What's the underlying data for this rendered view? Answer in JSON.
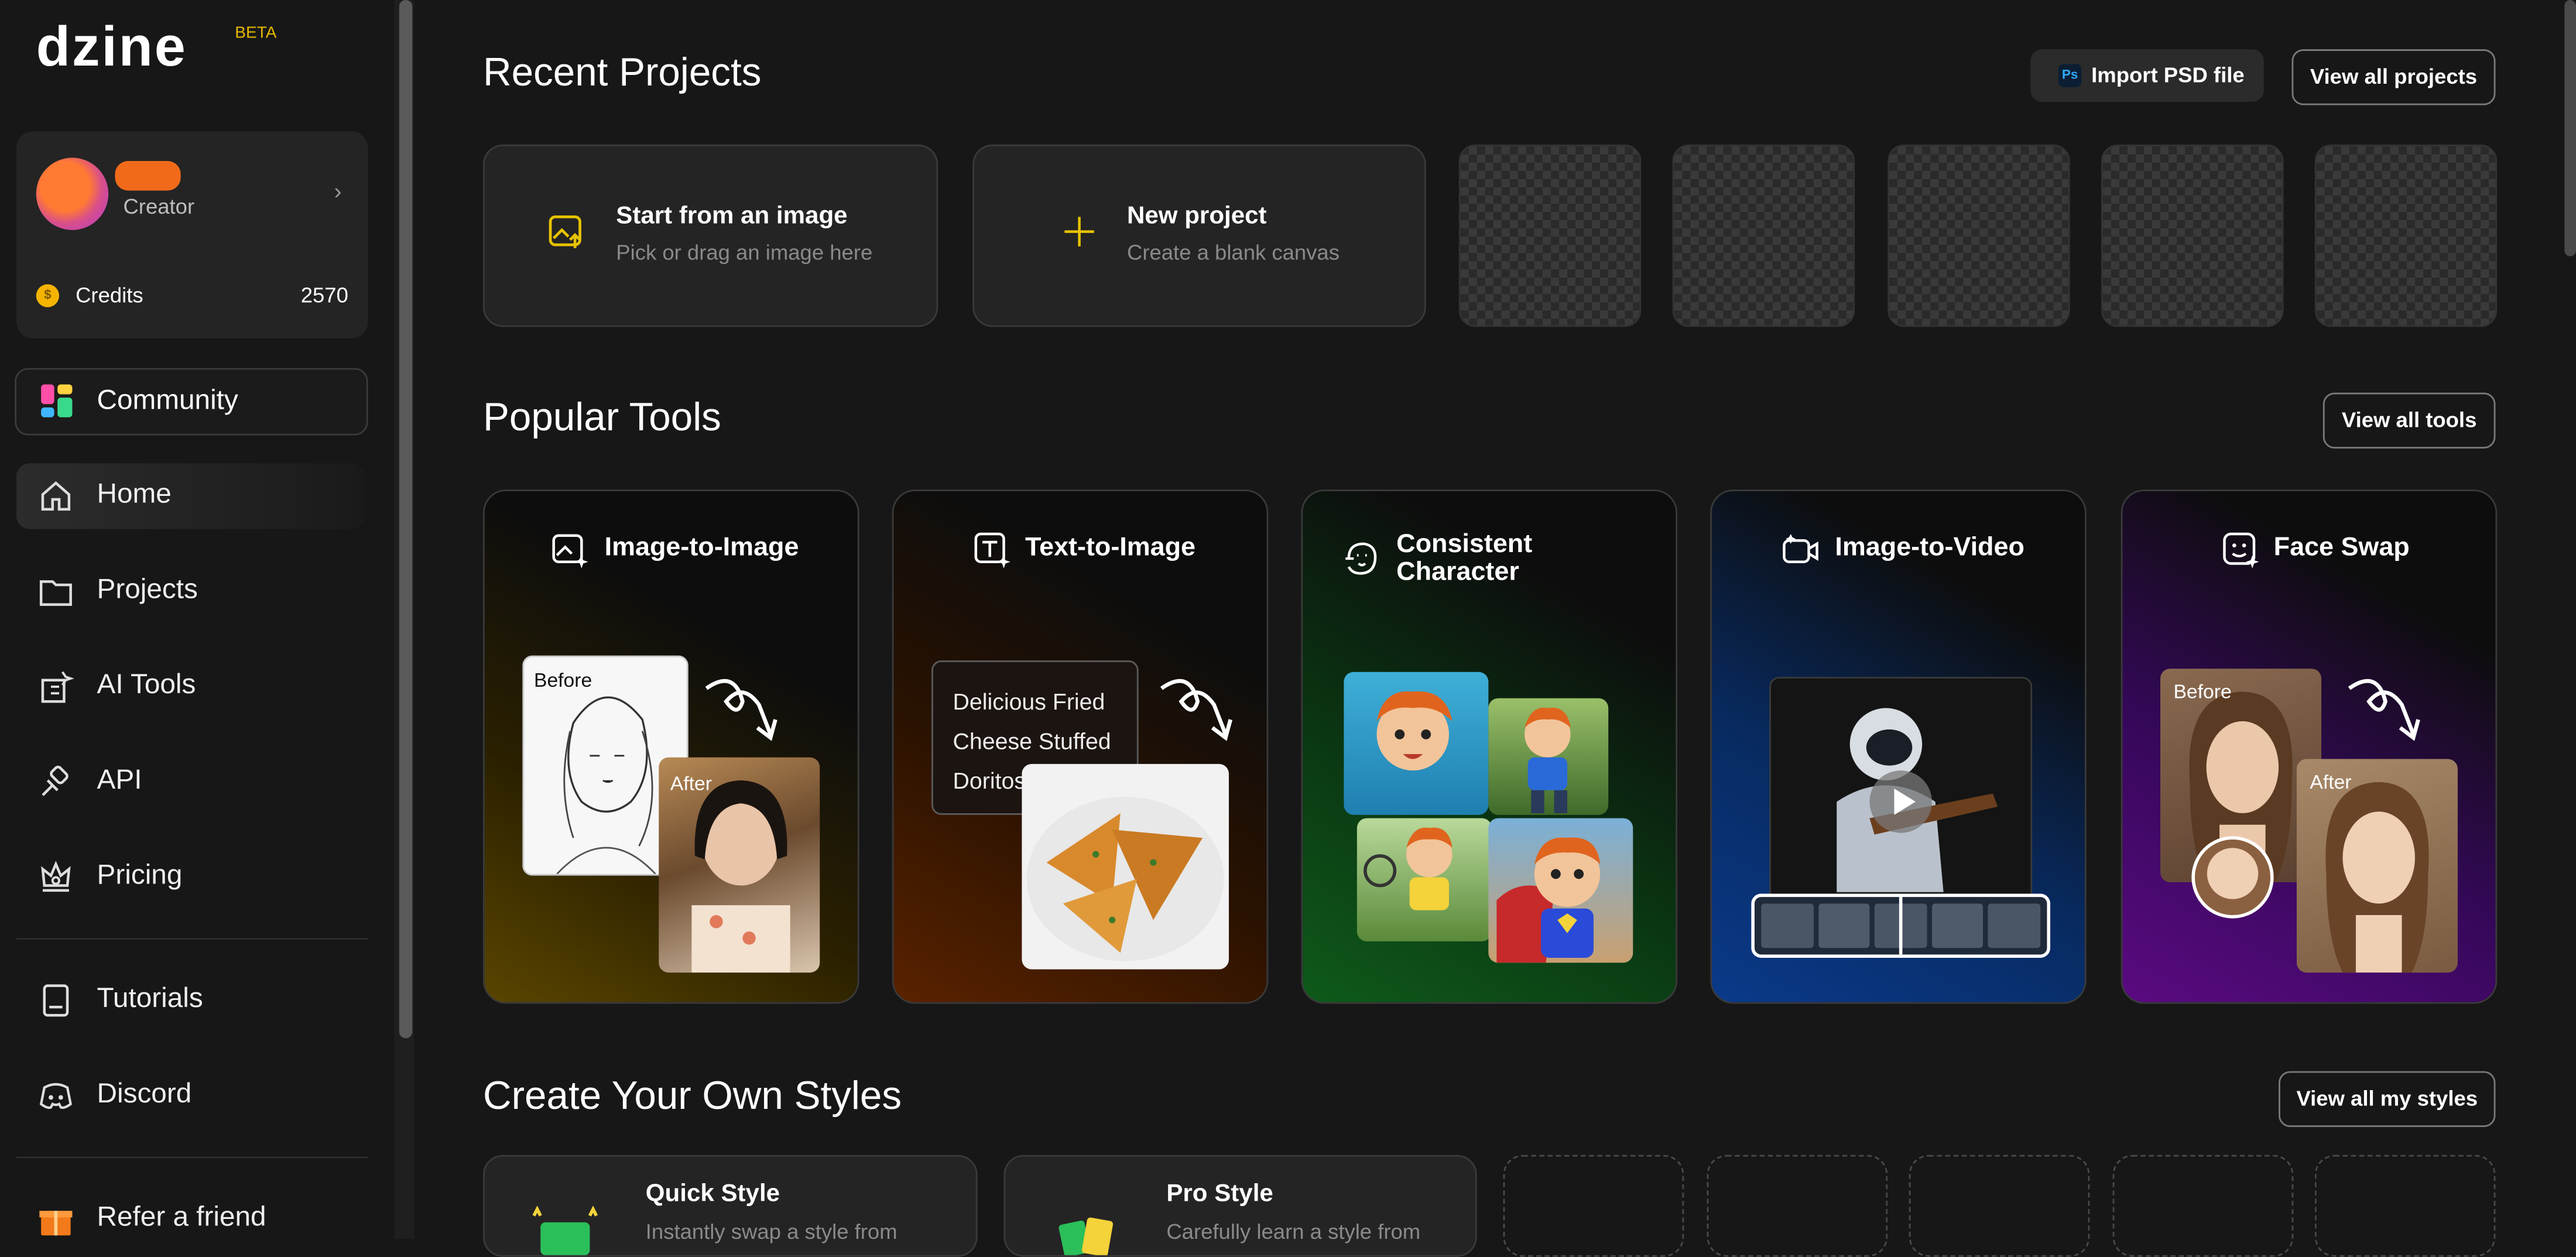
{
  "app": {
    "logo": "dzine",
    "badge": "BETA"
  },
  "user": {
    "role": "Creator",
    "credits_label": "Credits",
    "credits_value": "2570"
  },
  "sidebar": {
    "community": "Community",
    "items": [
      {
        "label": "Home",
        "icon": "home-icon"
      },
      {
        "label": "Projects",
        "icon": "folder-icon"
      },
      {
        "label": "AI Tools",
        "icon": "ai-tools-icon"
      },
      {
        "label": "API",
        "icon": "api-icon"
      },
      {
        "label": "Pricing",
        "icon": "pricing-icon"
      },
      {
        "label": "Tutorials",
        "icon": "tutorials-icon"
      },
      {
        "label": "Discord",
        "icon": "discord-icon"
      },
      {
        "label": "Refer a friend",
        "icon": "gift-icon"
      }
    ]
  },
  "recent": {
    "title": "Recent Projects",
    "import_btn": "Import PSD file",
    "import_badge": "Ps",
    "view_all": "View all projects",
    "start": {
      "title": "Start from an image",
      "subtitle": "Pick or drag an image here"
    },
    "new": {
      "title": "New project",
      "subtitle": "Create a blank canvas"
    }
  },
  "tools": {
    "title": "Popular Tools",
    "view_all": "View all tools",
    "items": [
      {
        "label": "Image-to-Image",
        "before": "Before",
        "after": "After"
      },
      {
        "label": "Text-to-Image",
        "prompt": [
          "Delicious Fried",
          "Cheese Stuffed",
          "Doritos"
        ]
      },
      {
        "label": "Consistent Character",
        "line1": "Consistent",
        "line2": "Character"
      },
      {
        "label": "Image-to-Video"
      },
      {
        "label": "Face Swap",
        "before": "Before",
        "after": "After"
      }
    ]
  },
  "styles": {
    "title": "Create Your Own Styles",
    "view_all": "View all my styles",
    "quick": {
      "title": "Quick Style",
      "subtitle": "Instantly swap a style from"
    },
    "pro": {
      "title": "Pro Style",
      "subtitle": "Carefully learn a style from"
    }
  },
  "colors": {
    "accent": "#e6c200",
    "bg": "#171717",
    "card": "#242424"
  }
}
